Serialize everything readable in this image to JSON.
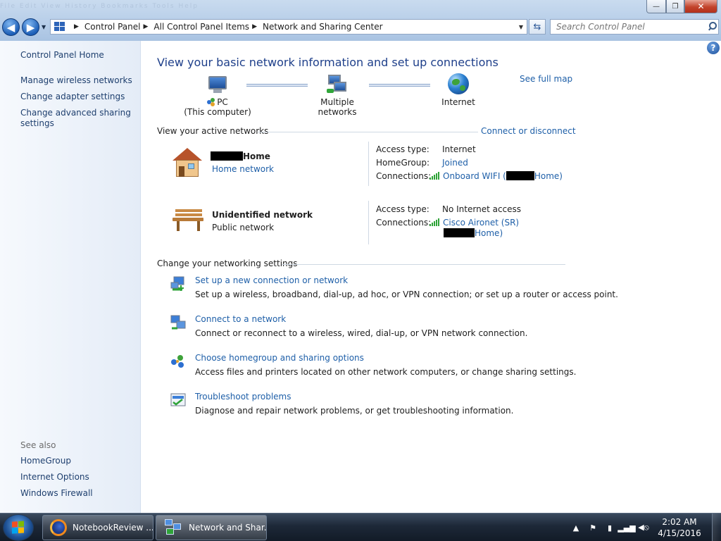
{
  "window": {
    "ghost_menu": "File  Edit  View  History  Bookmarks  Tools  Help",
    "minimize": "—",
    "maximize": "❐",
    "close": "✕"
  },
  "address": {
    "crumbs": [
      "Control Panel",
      "All Control Panel Items",
      "Network and Sharing Center"
    ],
    "search_placeholder": "Search Control Panel"
  },
  "sidebar": {
    "home": "Control Panel Home",
    "links": [
      "Manage wireless networks",
      "Change adapter settings",
      "Change advanced sharing settings"
    ],
    "see_also_label": "See also",
    "see_also": [
      "HomeGroup",
      "Internet Options",
      "Windows Firewall"
    ]
  },
  "main": {
    "title": "View your basic network information and set up connections",
    "see_full_map": "See full map",
    "map": {
      "pc_label": "PC",
      "pc_sub": "(This computer)",
      "networks_label": "Multiple networks",
      "internet_label": "Internet"
    },
    "active_heading": "View your active networks",
    "connect_disconnect": "Connect or disconnect",
    "networks": [
      {
        "name_suffix": "Home",
        "category": "Home network",
        "labels": [
          "Access type:",
          "HomeGroup:",
          "Connections:"
        ],
        "access_type": "Internet",
        "homegroup": "Joined",
        "connection_prefix": "Onboard WIFI (",
        "connection_suffix": "Home)"
      },
      {
        "name": "Unidentified network",
        "category": "Public network",
        "labels": [
          "Access type:",
          "Connections:"
        ],
        "access_type": "No Internet access",
        "connection_line1": "Cisco Aironet (SR)",
        "connection_line2_suffix": "Home)"
      }
    ],
    "settings_heading": "Change your networking settings",
    "tasks": [
      {
        "link": "Set up a new connection or network",
        "desc": "Set up a wireless, broadband, dial-up, ad hoc, or VPN connection; or set up a router or access point."
      },
      {
        "link": "Connect to a network",
        "desc": "Connect or reconnect to a wireless, wired, dial-up, or VPN network connection."
      },
      {
        "link": "Choose homegroup and sharing options",
        "desc": "Access files and printers located on other network computers, or change sharing settings."
      },
      {
        "link": "Troubleshoot problems",
        "desc": "Diagnose and repair network problems, or get troubleshooting information."
      }
    ]
  },
  "taskbar": {
    "firefox_label": "NotebookReview ...",
    "network_label": "Network and Shar...",
    "time": "2:02 AM",
    "date": "4/15/2016"
  },
  "colors": {
    "link": "#1e5fa8",
    "title": "#1e3f8a",
    "signal": "#2fa338"
  }
}
